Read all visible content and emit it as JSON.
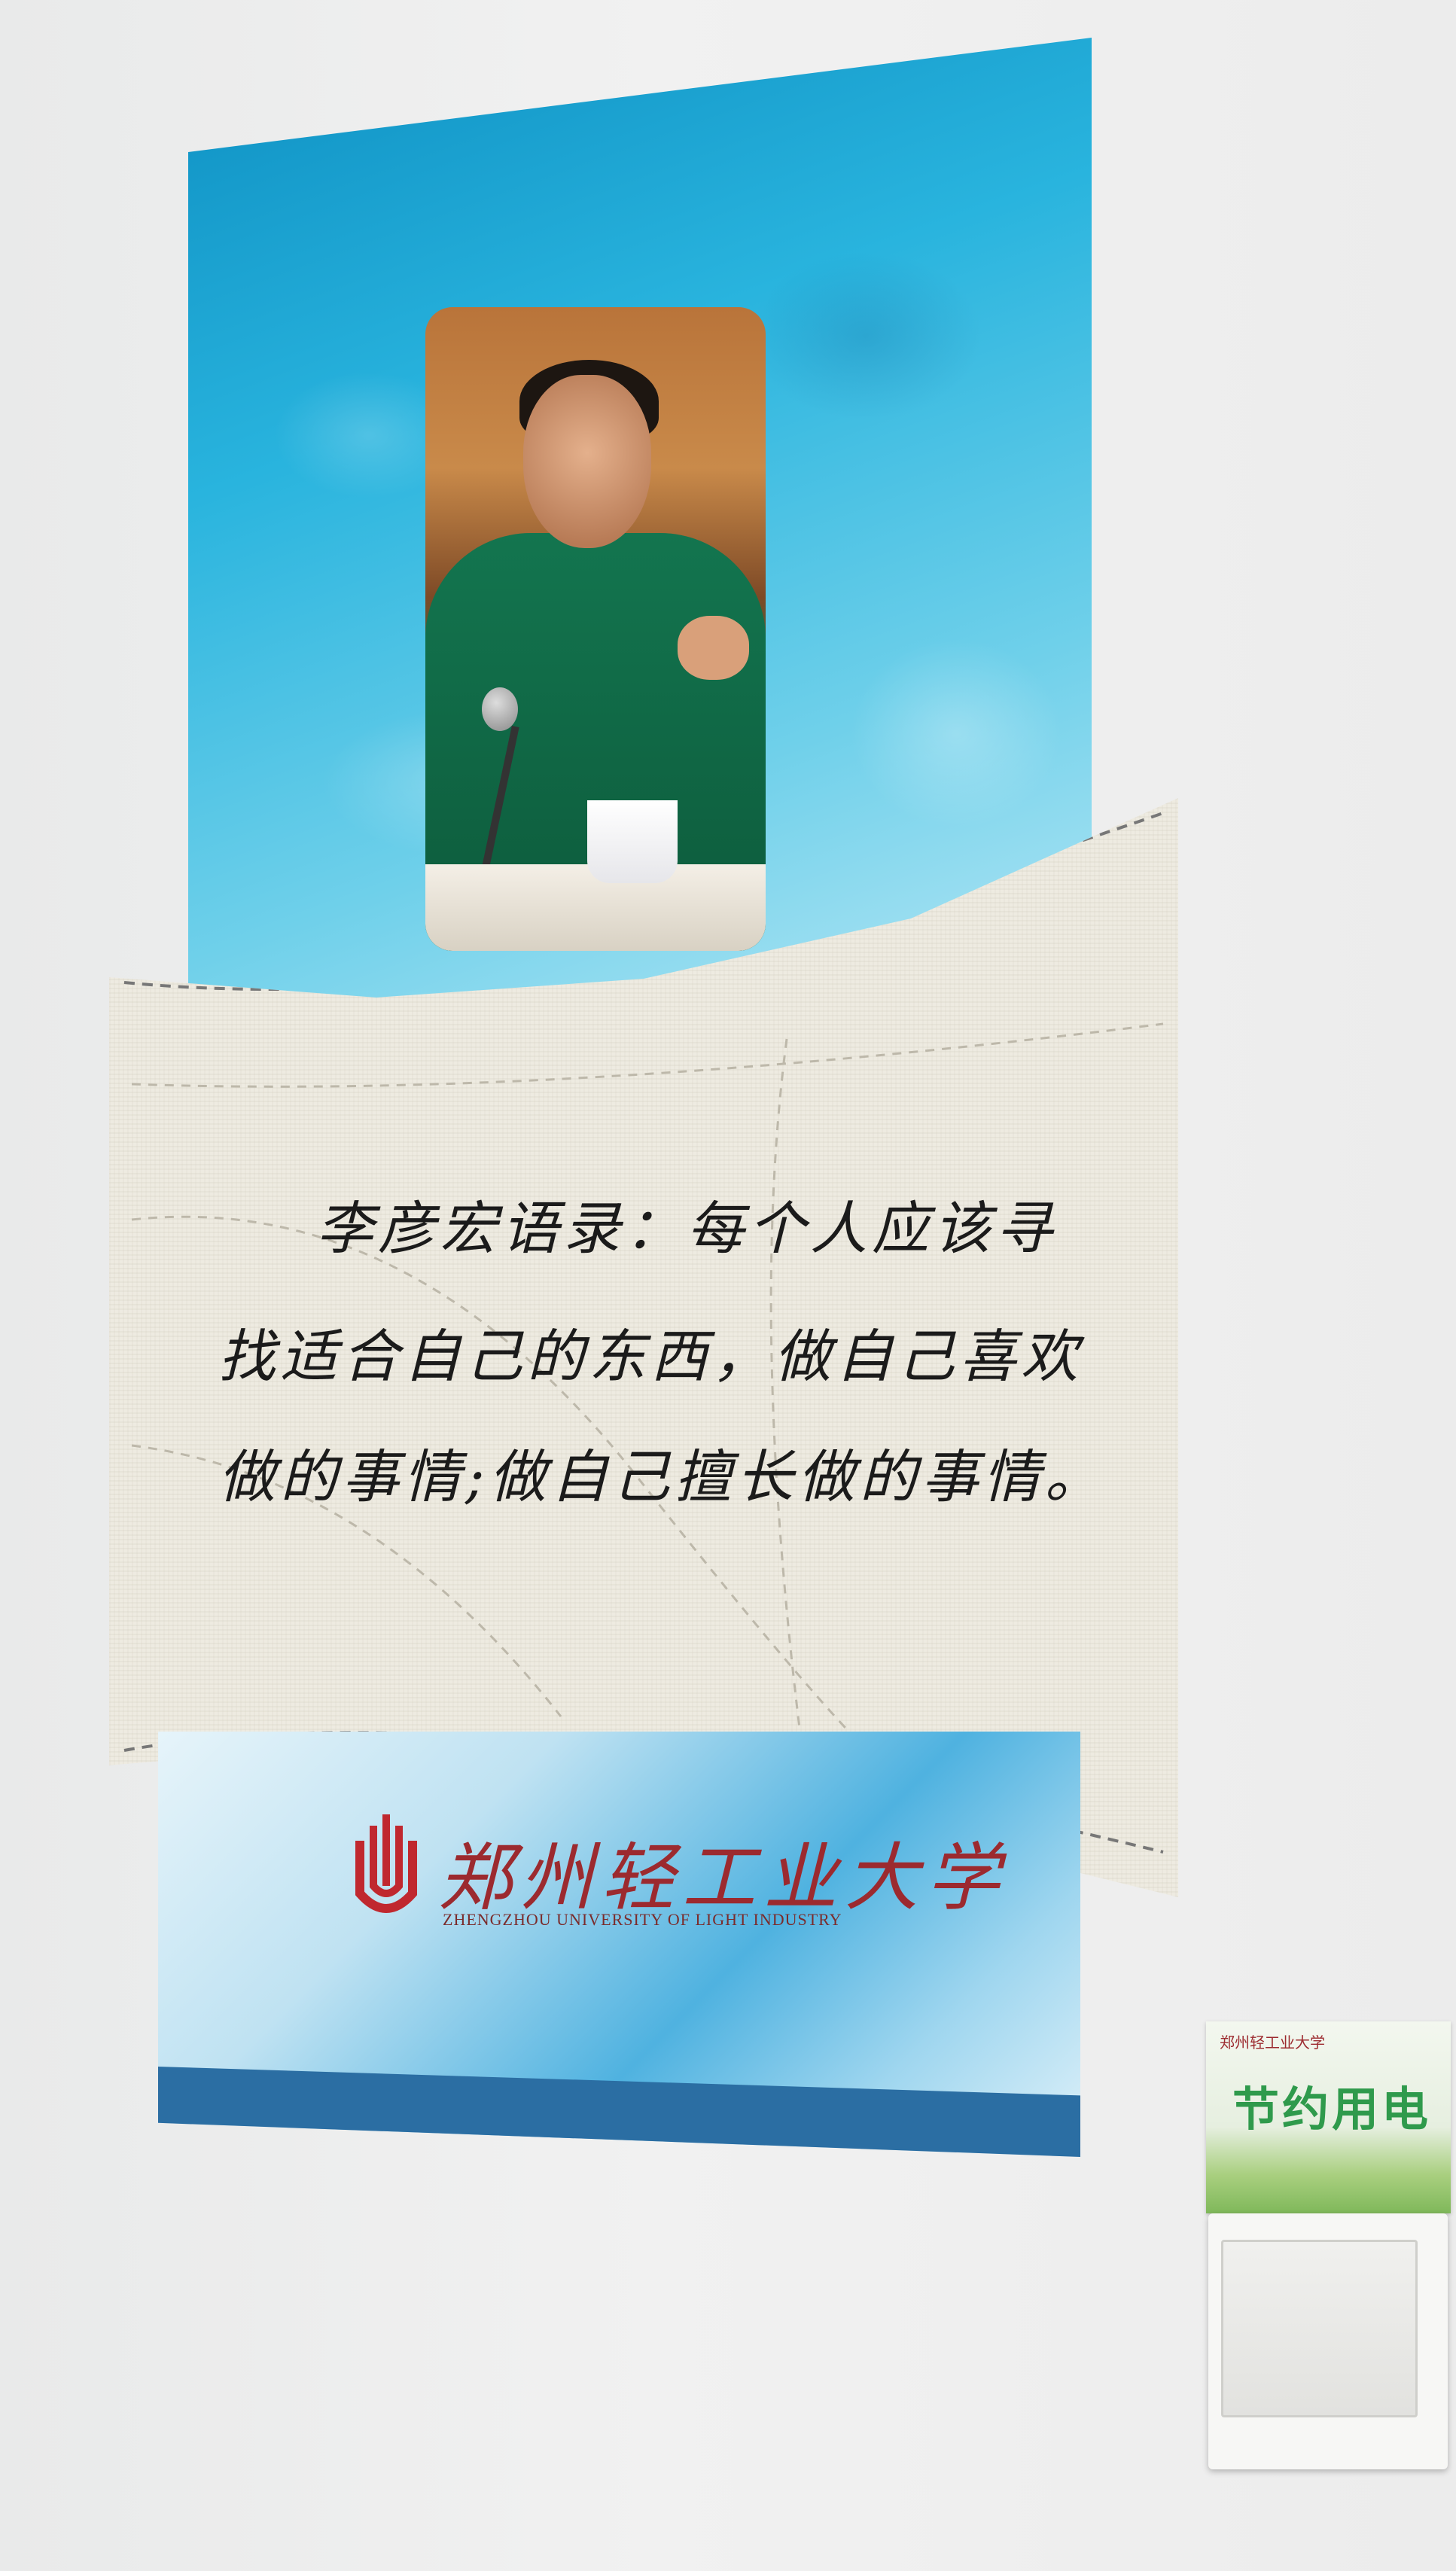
{
  "poster": {
    "quote_line1": "李彦宏语录：每个人应该寻",
    "quote_line2": "找适合自己的东西，做自己喜欢",
    "quote_line3": "做的事情;做自己擅长做的事情。"
  },
  "university": {
    "name_cn": "郑州轻工业大学",
    "name_en": "ZHENGZHOU UNIVERSITY OF LIGHT INDUSTRY",
    "logo_icon": "university-logo-icon",
    "brand_color": "#9c2a2f"
  },
  "switch_sign": {
    "mini_logo_text": "郑州轻工业大学",
    "label": "节约用电",
    "accent_color": "#2f9a4c"
  },
  "colors": {
    "panel_blue": "#29b4de",
    "board_cream": "#eeebe1",
    "stripe_blue": "#2b6ea3"
  }
}
